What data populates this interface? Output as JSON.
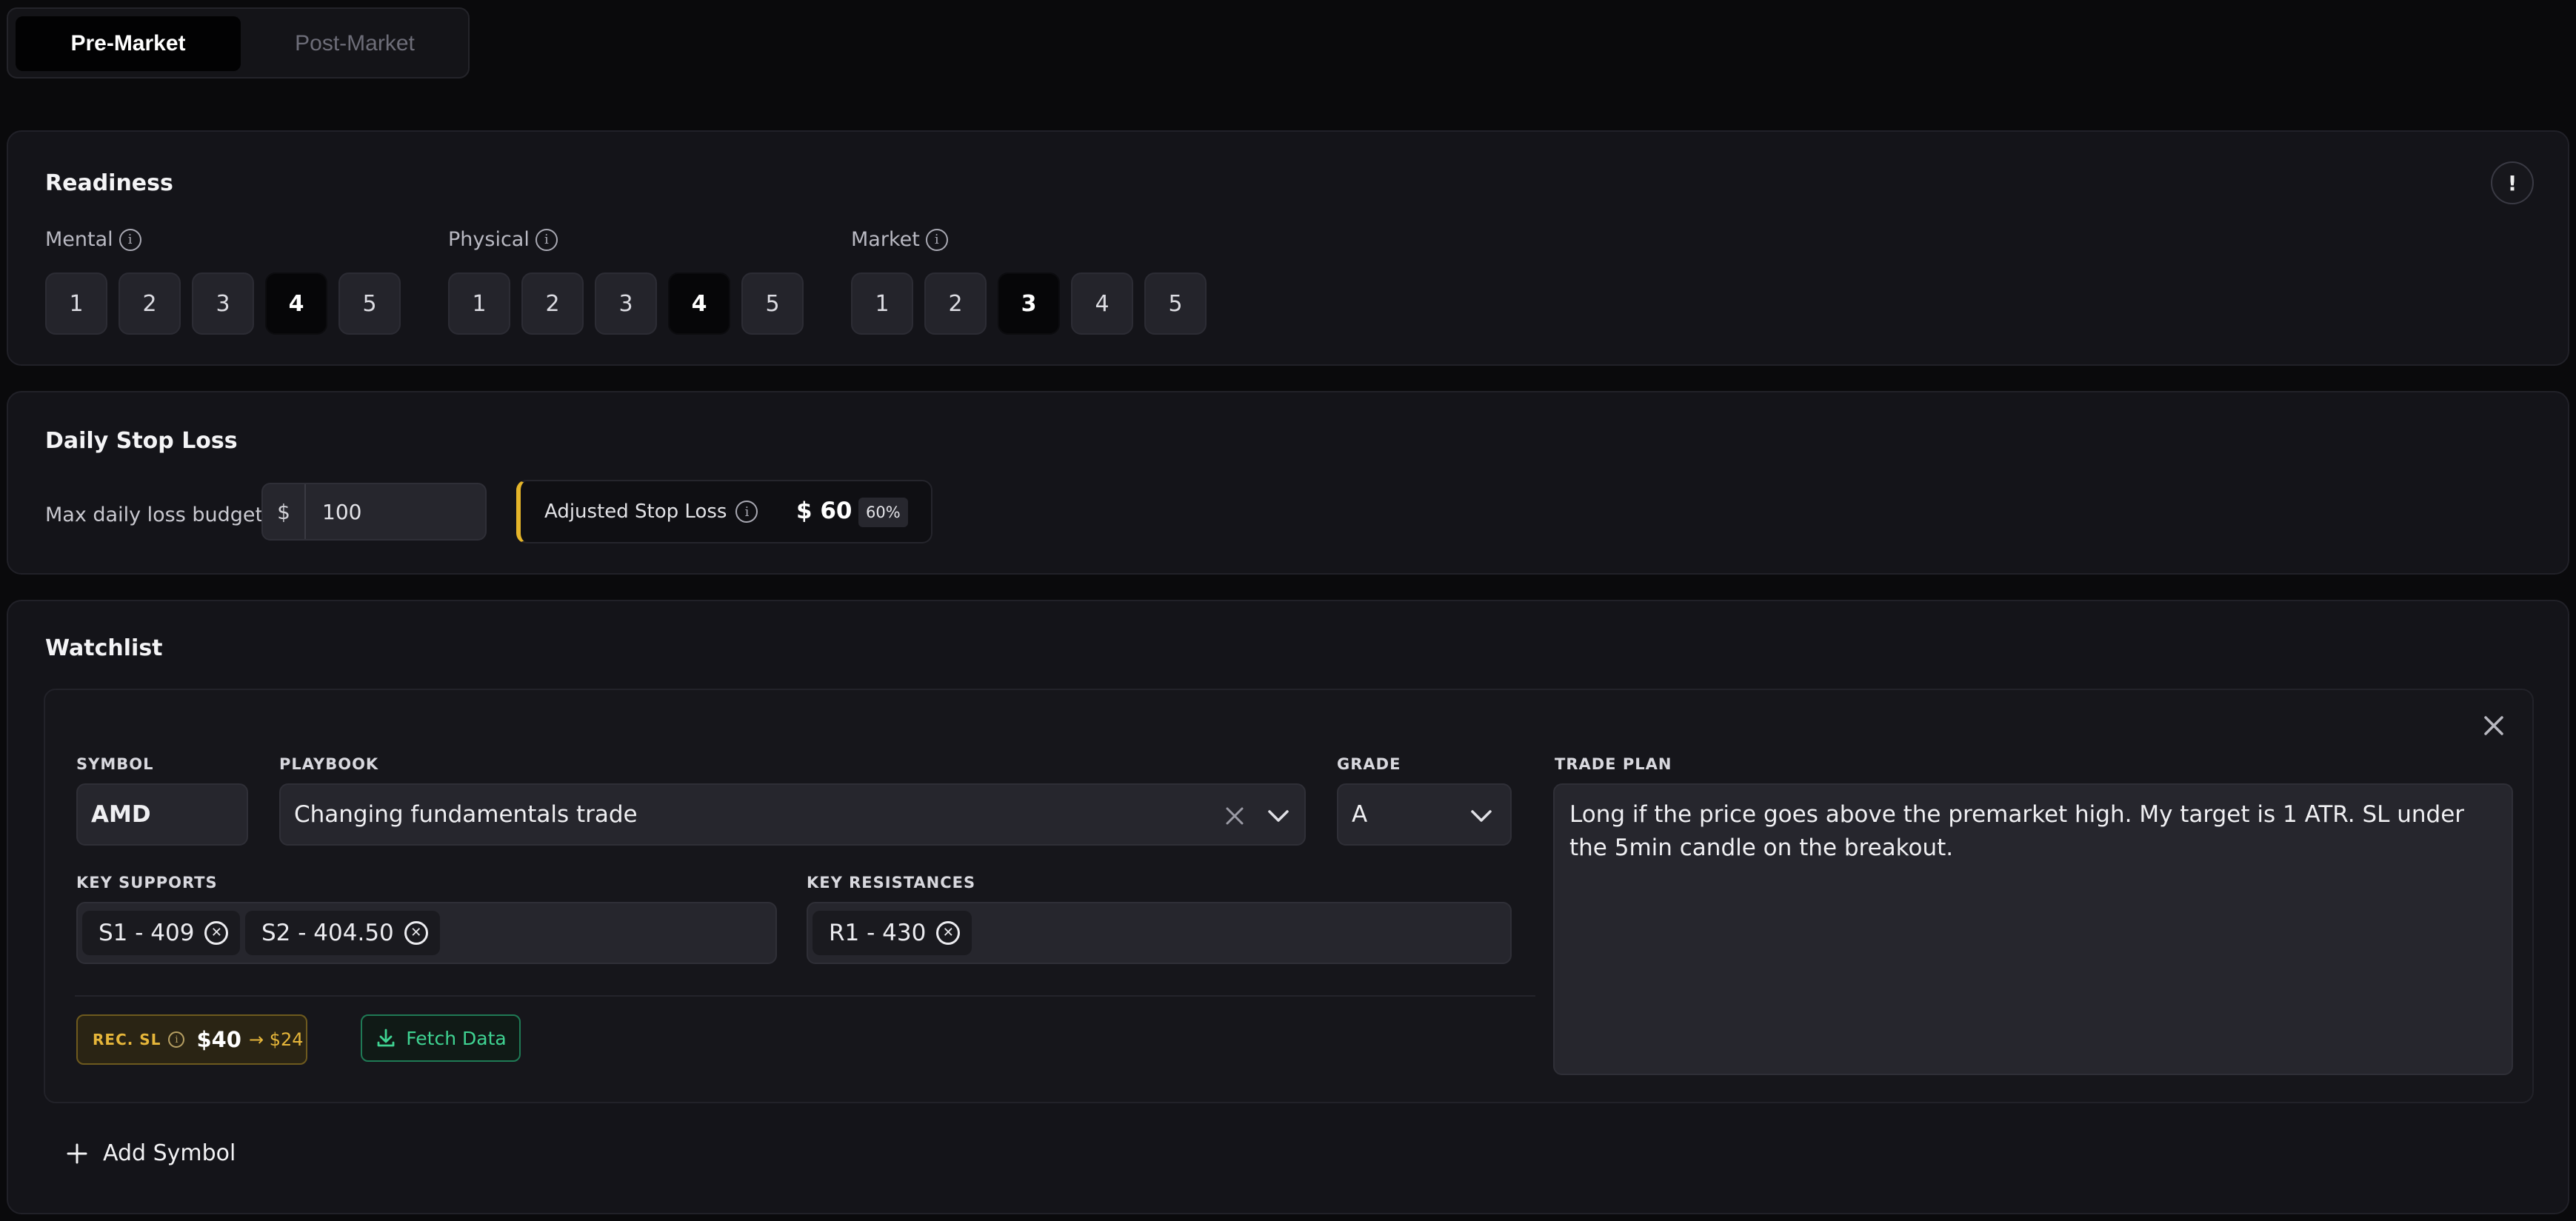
{
  "tabs": {
    "pre_market": "Pre-Market",
    "post_market": "Post-Market"
  },
  "readiness": {
    "title": "Readiness",
    "alert_symbol": "!",
    "groups": [
      {
        "label": "Mental",
        "selected": 4,
        "options": [
          "1",
          "2",
          "3",
          "4",
          "5"
        ]
      },
      {
        "label": "Physical",
        "selected": 4,
        "options": [
          "1",
          "2",
          "3",
          "4",
          "5"
        ]
      },
      {
        "label": "Market",
        "selected": 3,
        "options": [
          "1",
          "2",
          "3",
          "4",
          "5"
        ]
      }
    ],
    "info_glyph": "i"
  },
  "daily_stop_loss": {
    "title": "Daily Stop Loss",
    "budget_label": "Max daily loss budget",
    "currency": "$",
    "budget_value": "100",
    "adjusted_label": "Adjusted Stop Loss",
    "adjusted_value": "$ 60",
    "adjusted_pct": "60%",
    "accent_color": "#e5b52a"
  },
  "watchlist": {
    "title": "Watchlist",
    "item": {
      "symbol_label": "SYMBOL",
      "symbol": "AMD",
      "playbook_label": "PLAYBOOK",
      "playbook": "Changing fundamentals trade",
      "grade_label": "GRADE",
      "grade": "A",
      "trade_plan_label": "TRADE PLAN",
      "trade_plan": "Long if the price goes above the premarket high. My target is 1 ATR. SL under the 5min candle on the breakout.",
      "supports_label": "KEY SUPPORTS",
      "supports": [
        "S1 - 409",
        "S2 - 404.50"
      ],
      "resistances_label": "KEY RESISTANCES",
      "resistances": [
        "R1 - 430"
      ],
      "rec_sl_label": "REC. SL",
      "rec_sl_value": "$40",
      "rec_sl_adjusted": "→ $24",
      "fetch_label": "Fetch Data"
    },
    "add_symbol": "Add Symbol"
  }
}
